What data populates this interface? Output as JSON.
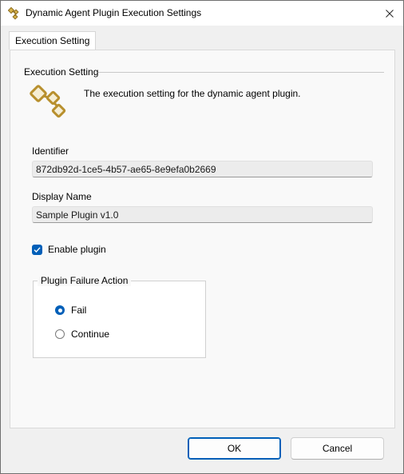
{
  "window": {
    "title": "Dynamic Agent Plugin Execution Settings",
    "close_glyph": "✕"
  },
  "tabs": [
    {
      "label": "Execution Setting",
      "selected": true
    }
  ],
  "section": {
    "header": "Execution Setting",
    "description": "The execution setting for the dynamic agent plugin.",
    "icon": "plugin-nodes-icon"
  },
  "fields": {
    "identifier": {
      "label": "Identifier",
      "value": "872db92d-1ce5-4b57-ae65-8e9efa0b2669"
    },
    "display_name": {
      "label": "Display Name",
      "value": "Sample Plugin v1.0"
    }
  },
  "enable_plugin": {
    "label": "Enable plugin",
    "checked": true
  },
  "failure_action": {
    "title": "Plugin Failure Action",
    "options": [
      {
        "label": "Fail",
        "selected": true
      },
      {
        "label": "Continue",
        "selected": false
      }
    ]
  },
  "buttons": {
    "ok": "OK",
    "cancel": "Cancel"
  },
  "colors": {
    "accent": "#005fb8",
    "icon_gold": "#b8902e"
  }
}
